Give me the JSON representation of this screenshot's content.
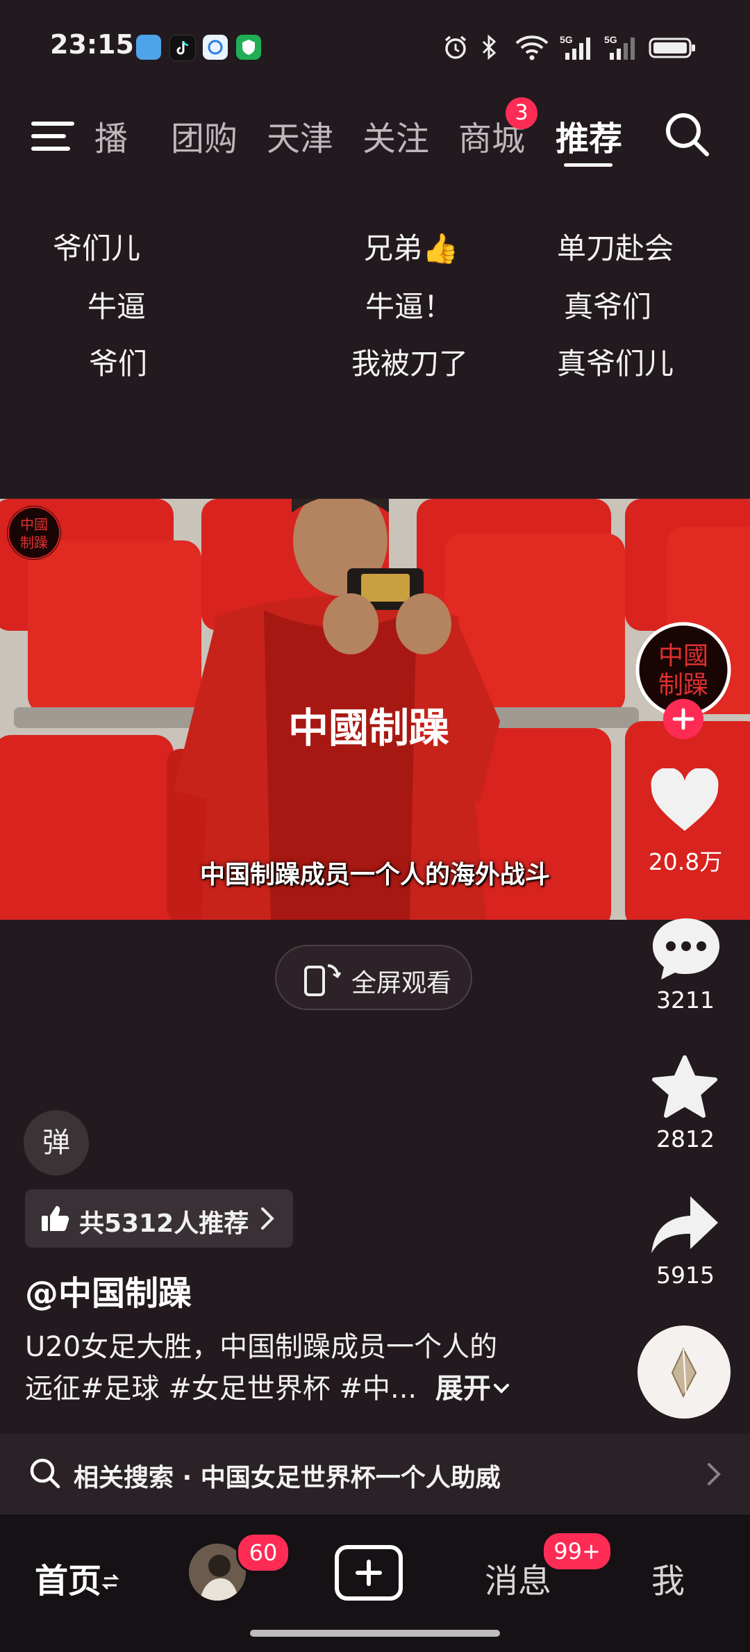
{
  "status_bar": {
    "time": "23:15",
    "app_icons": [
      "weather-app-icon",
      "tiktok-app-icon",
      "chat-app-icon",
      "security-app-icon"
    ],
    "icons": [
      "alarm-icon",
      "bluetooth-icon",
      "wifi-icon",
      "signal-5g-icon",
      "signal-5g-icon",
      "battery-icon"
    ]
  },
  "nav": {
    "tabs": [
      "播",
      "团购",
      "天津",
      "关注",
      "商城",
      "推荐"
    ],
    "active_tab": "推荐",
    "mall_badge": "3"
  },
  "danmaku": [
    "爷们儿",
    "兄弟👍",
    "单刀赴会",
    "牛逼",
    "牛逼！",
    "真爷们",
    "爷们",
    "我被刀了",
    "真爷们儿"
  ],
  "video": {
    "caption": "中国制躁成员一个人的海外战斗",
    "shirt_text": "中國制躁"
  },
  "fullscreen": {
    "label": "全屏观看"
  },
  "rail": {
    "likes": "20.8万",
    "comments": "3211",
    "favorites": "2812",
    "shares": "5915"
  },
  "danmu_toggle": "弹",
  "recommend": {
    "text": "共5312人推荐"
  },
  "post": {
    "author": "@中国制躁",
    "desc_line1": "U20女足大胜，中国制躁成员一个人的",
    "desc_line2": "远征#足球 #女足世界杯 #中...",
    "expand": "展开"
  },
  "related_search": {
    "text": "相关搜索 · 中国女足世界杯一个人助威"
  },
  "bottom_nav": {
    "home": "首页",
    "friends_badge": "60",
    "messages": "消息",
    "messages_badge": "99+",
    "me": "我"
  },
  "colors": {
    "accent": "#fe2c55",
    "background": "#231a1f",
    "seat_red": "#d8231f"
  }
}
